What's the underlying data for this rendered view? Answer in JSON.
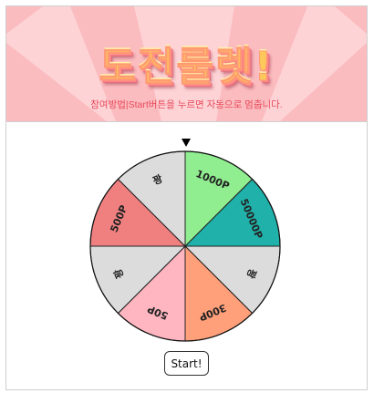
{
  "banner": {
    "title": "도전룰렛!",
    "instruction": "참여방법|Start버튼을 누르면 자동으로 멈춥니다."
  },
  "wheel": {
    "segments": [
      {
        "label": "1000P",
        "color": "#90ee90"
      },
      {
        "label": "50000P",
        "color": "#20b2aa"
      },
      {
        "label": "꽝",
        "color": "#dcdcdc"
      },
      {
        "label": "300P",
        "color": "#ffa07a"
      },
      {
        "label": "50P",
        "color": "#ffb6c1"
      },
      {
        "label": "꽝",
        "color": "#dcdcdc"
      },
      {
        "label": "500P",
        "color": "#f08080"
      },
      {
        "label": "꽝",
        "color": "#dcdcdc"
      }
    ]
  },
  "controls": {
    "start_label": "Start!"
  }
}
